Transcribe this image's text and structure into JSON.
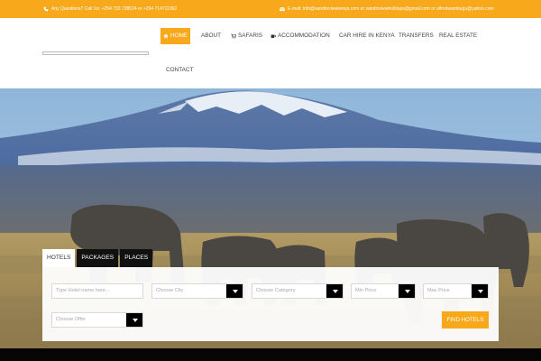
{
  "topbar": {
    "phone_text": "Any Questions? Call Us: +254 733 738524 or +254 714711362",
    "email_text": "E-mail: info@sandtoviewkenya.com or sandtoviewholidays@gmail.com or alfredwambugu@yahoo.com"
  },
  "nav": {
    "items": [
      {
        "label": "HOME",
        "icon": "home-icon"
      },
      {
        "label": "ABOUT"
      },
      {
        "label": "SAFARIS",
        "icon": "cart-icon"
      },
      {
        "label": "ACCOMMODATION",
        "icon": "cup-icon"
      },
      {
        "label": "CAR HIRE IN KENYA"
      },
      {
        "label": "TRANSFERS"
      },
      {
        "label": "REAL ESTATE"
      },
      {
        "label": "CONTACT"
      }
    ]
  },
  "search": {
    "tabs": [
      "HOTELS",
      "PACKAGES",
      "PLACES"
    ],
    "hotel_name_placeholder": "Type Hotel name here...",
    "city": "Choose City",
    "category": "Choose Category",
    "min_price": "Min Price",
    "max_price": "Max Price",
    "offer": "Choose Offer",
    "button": "FIND HOTELS"
  },
  "colors": {
    "accent": "#f7a81b",
    "dark": "#111111"
  }
}
